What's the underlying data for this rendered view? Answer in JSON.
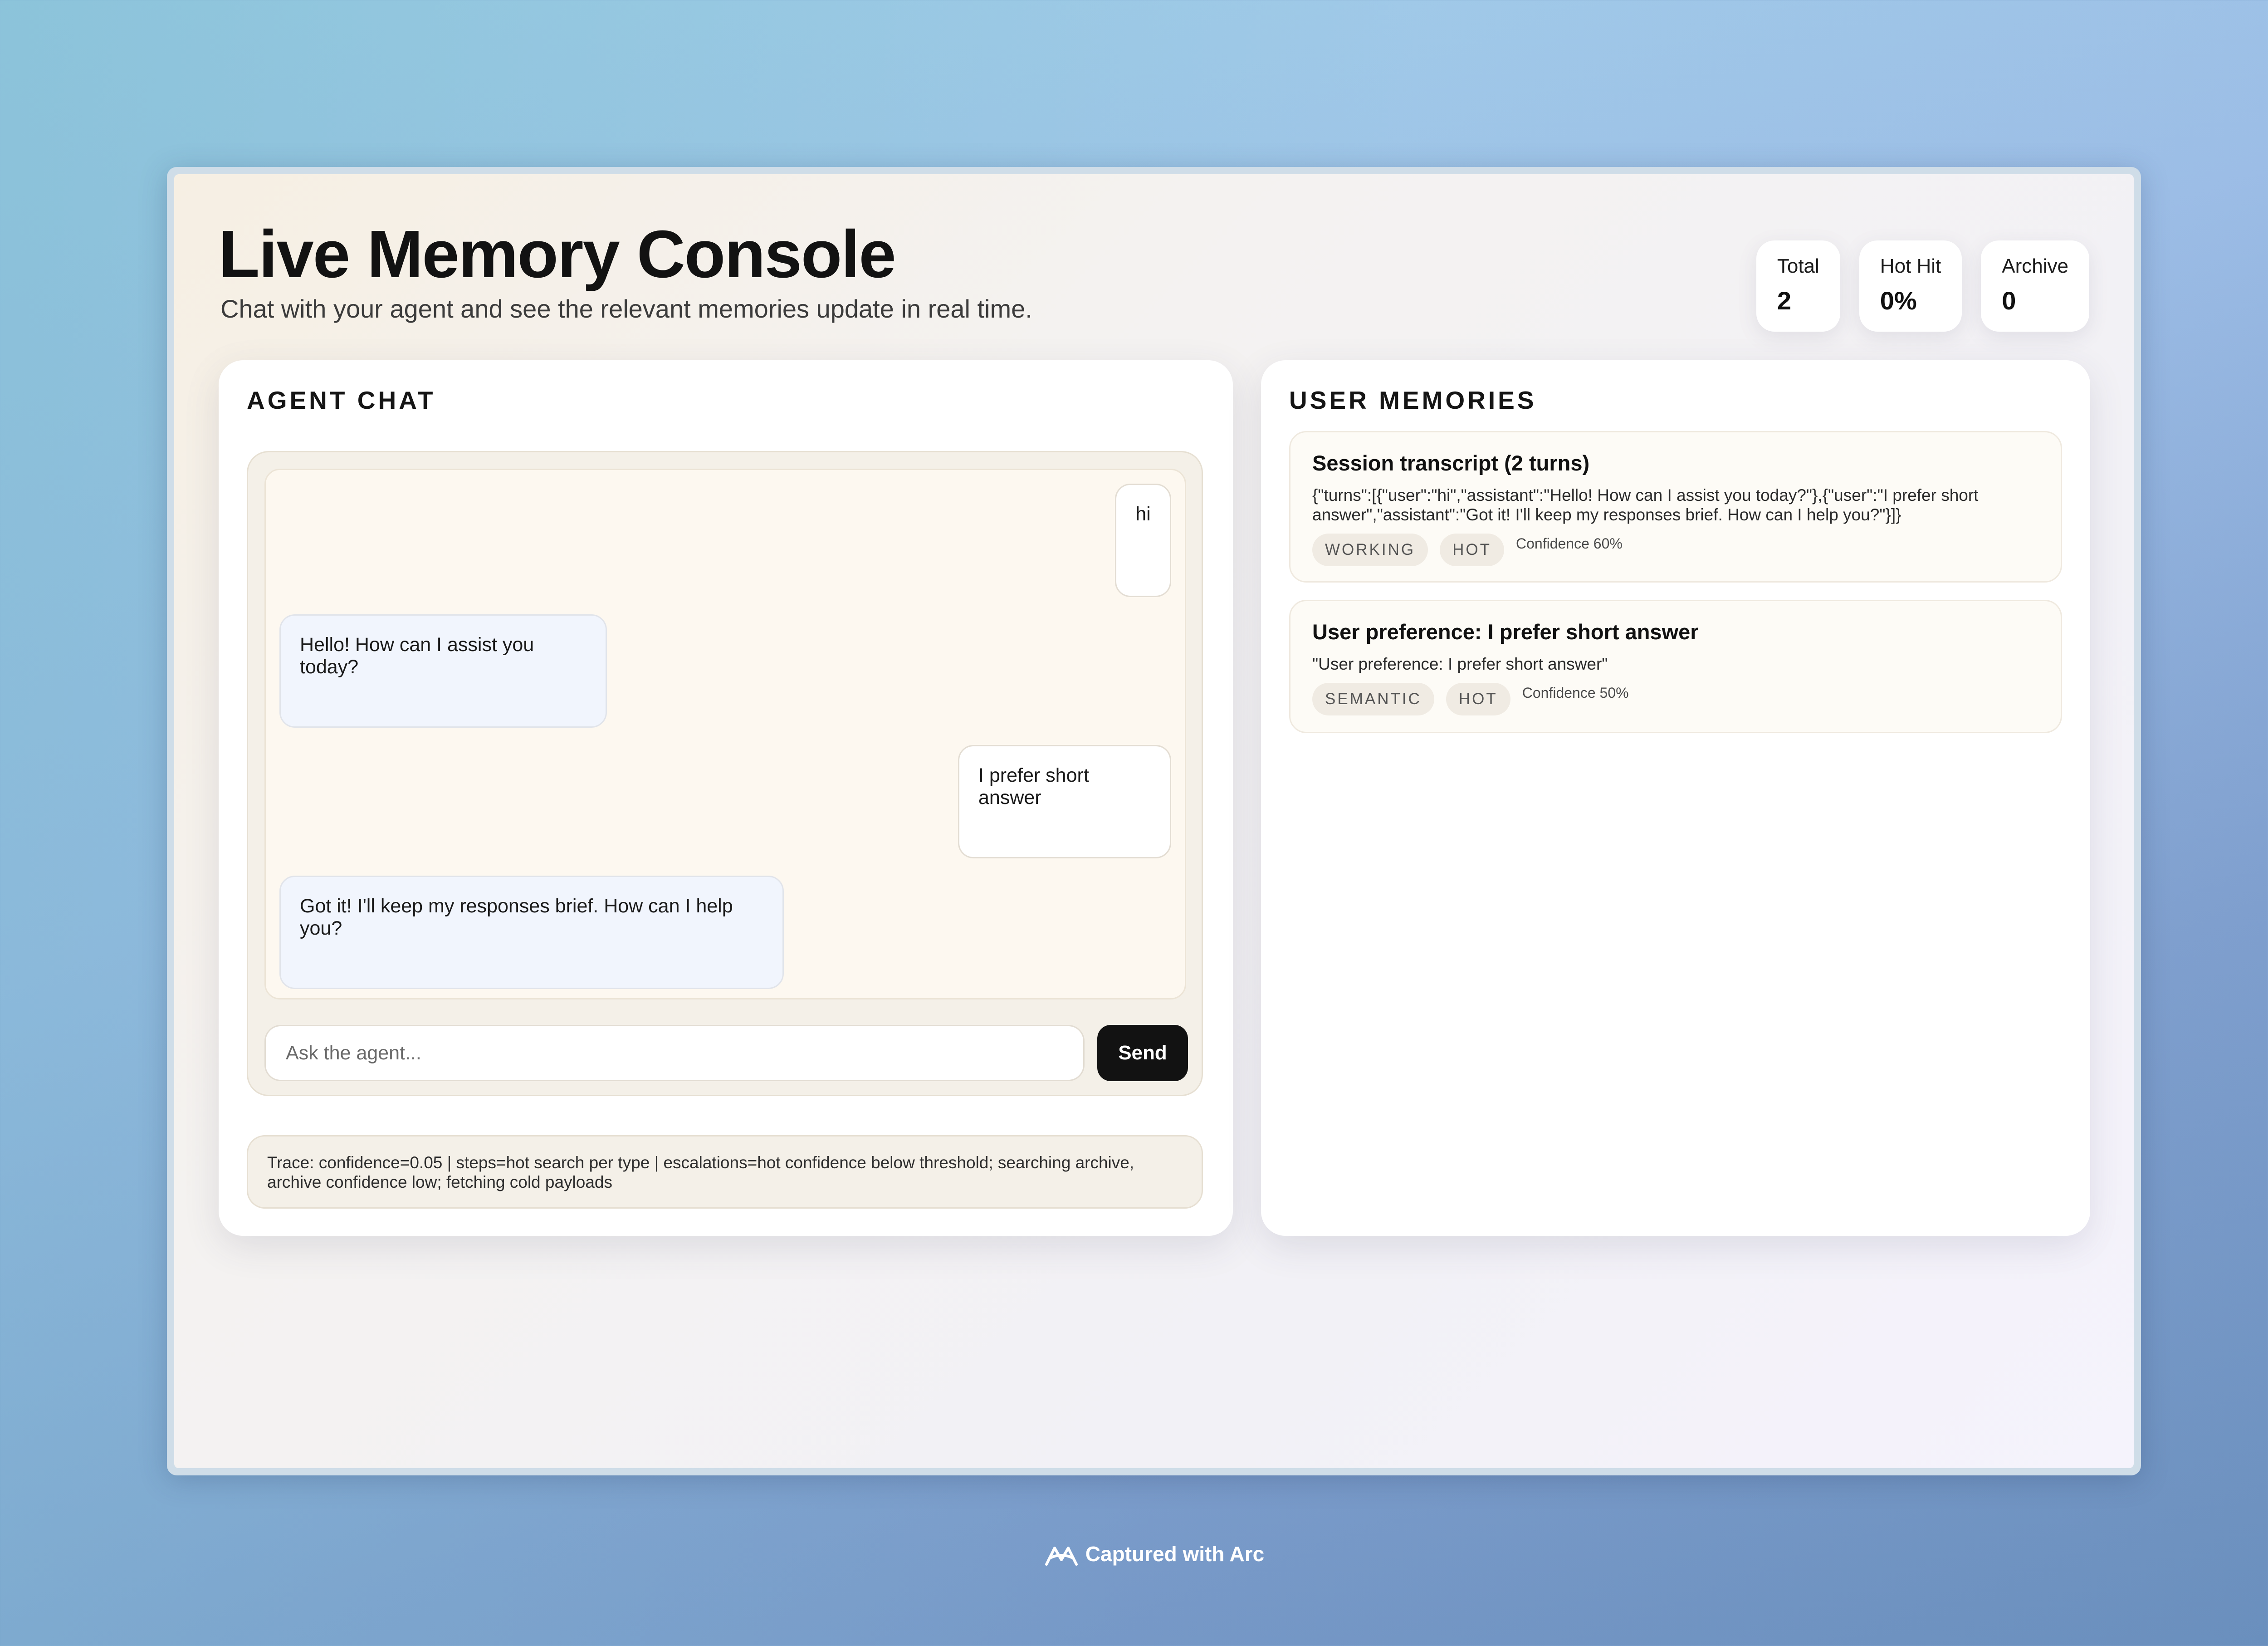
{
  "header": {
    "title": "Live Memory Console",
    "subtitle": "Chat with your agent and see the relevant memories update in real time."
  },
  "stats": [
    {
      "label": "Total",
      "value": "2"
    },
    {
      "label": "Hot Hit",
      "value": "0%"
    },
    {
      "label": "Archive",
      "value": "0"
    }
  ],
  "chat": {
    "title": "AGENT CHAT",
    "messages": [
      {
        "role": "user",
        "text": "hi"
      },
      {
        "role": "assistant",
        "text": "Hello! How can I assist you today?"
      },
      {
        "role": "user",
        "text": "I prefer short answer"
      },
      {
        "role": "assistant",
        "text": "Got it! I'll keep my responses brief. How can I help you?"
      }
    ],
    "input_placeholder": "Ask the agent...",
    "send_label": "Send",
    "trace": "Trace: confidence=0.05 | steps=hot search per type | escalations=hot confidence below threshold; searching archive, archive confidence low; fetching cold payloads"
  },
  "memories": {
    "title": "USER MEMORIES",
    "items": [
      {
        "title": "Session transcript (2 turns)",
        "body": "{\"turns\":[{\"user\":\"hi\",\"assistant\":\"Hello! How can I assist you today?\"},{\"user\":\"I prefer short answer\",\"assistant\":\"Got it! I'll keep my responses brief. How can I help you?\"}]}",
        "tags": [
          "WORKING",
          "HOT"
        ],
        "confidence": "Confidence 60%"
      },
      {
        "title": "User preference: I prefer short answer",
        "body": "\"User preference: I prefer short answer\"",
        "tags": [
          "SEMANTIC",
          "HOT"
        ],
        "confidence": "Confidence 50%"
      }
    ]
  },
  "footer": {
    "label": "Captured with Arc",
    "icon": "arc-logo-icon"
  }
}
